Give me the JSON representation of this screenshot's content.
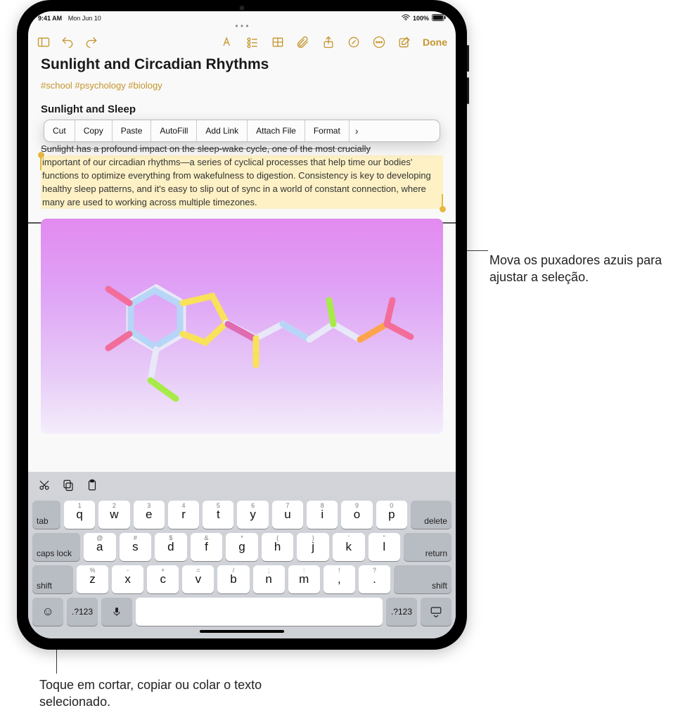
{
  "status": {
    "time": "9:41 AM",
    "date": "Mon Jun 10",
    "battery": "100%"
  },
  "toolbar": {
    "done": "Done"
  },
  "note": {
    "title": "Sunlight and Circadian Rhythms",
    "tags": "#school #psychology #biology",
    "heading2": "Sunlight and Sleep",
    "line1": "Sunlight has a profound impact on the sleep-wake cycle, one of the most crucially",
    "selected": "important of our circadian rhythms—a series of cyclical processes that help time our bodies' functions to optimize everything from wakefulness to digestion. Consistency is key to developing healthy sleep patterns, and it's easy to slip out of sync in a world of constant connection, where many are used to working across multiple timezones."
  },
  "edit_menu": {
    "items": [
      "Cut",
      "Copy",
      "Paste",
      "AutoFill",
      "Add Link",
      "Attach File",
      "Format"
    ]
  },
  "keyboard": {
    "row1_alt": [
      "1",
      "2",
      "3",
      "4",
      "5",
      "6",
      "7",
      "8",
      "9",
      "0"
    ],
    "row1": [
      "q",
      "w",
      "e",
      "r",
      "t",
      "y",
      "u",
      "i",
      "o",
      "p"
    ],
    "row2_alt": [
      "@",
      "#",
      "$",
      "&",
      "*",
      "(",
      ")",
      "'",
      "\""
    ],
    "row2": [
      "a",
      "s",
      "d",
      "f",
      "g",
      "h",
      "j",
      "k",
      "l"
    ],
    "row3_alt": [
      "%",
      "-",
      "+",
      "=",
      "/",
      ";",
      ":",
      "!",
      "?"
    ],
    "row3": [
      "z",
      "x",
      "c",
      "v",
      "b",
      "n",
      "m",
      ",",
      "."
    ],
    "tab": "tab",
    "delete": "delete",
    "caps": "caps lock",
    "return": "return",
    "shift": "shift",
    "numkey": ".?123"
  },
  "callouts": {
    "right": "Mova os puxadores azuis para ajustar a seleção.",
    "bottom": "Toque em cortar, copiar ou colar o texto selecionado."
  }
}
